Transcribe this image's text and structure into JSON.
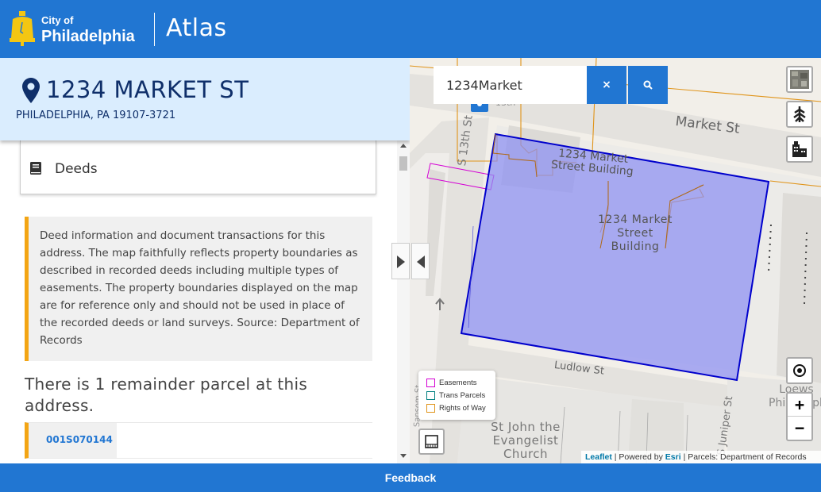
{
  "header": {
    "city_of": "City of",
    "city_name": "Philadelphia",
    "app_title": "Atlas"
  },
  "address": {
    "title": "1234 MARKET ST",
    "subtitle": "PHILADELPHIA, PA 19107-3721"
  },
  "topic": {
    "label": "Deeds",
    "icon": "book-icon"
  },
  "callout": {
    "text": "Deed information and document transactions for this address. The map faithfully reflects property boundaries as described in recorded deeds including multiple types of easements. The property boundaries displayed on the map are for reference only and should not be used in place of the recorded deeds or land surveys. Source: Department of Records"
  },
  "parcels": {
    "heading": "There is 1 remainder parcel at this address.",
    "rows": [
      {
        "id": "001S070144"
      }
    ]
  },
  "search": {
    "value": "1234Market",
    "clear_label": "×"
  },
  "map": {
    "labels": {
      "market_st": "Market St",
      "ludlow_st": "Ludlow St",
      "s_13th_st": "S 13th St",
      "s_juniper": "S Juniper St",
      "building_top": "1234 Market Street Building",
      "building_center": "1234 Market Street Building",
      "church": "St John the Evangelist Church",
      "right_edge": "Loews Philadelphia",
      "station_short": "13th",
      "sansom": "Sansom St"
    },
    "legend": [
      {
        "label": "Easements",
        "color": "#d400d4"
      },
      {
        "label": "Trans Parcels",
        "color": "#008080"
      },
      {
        "label": "Rights of Way",
        "color": "#e0941a"
      }
    ],
    "zoom_in": "+",
    "zoom_out": "−",
    "attribution": {
      "leaflet": "Leaflet",
      "powered": "| Powered by",
      "esri": "Esri",
      "parcels": "| Parcels: Department of Records"
    }
  },
  "footer": {
    "feedback": "Feedback"
  },
  "colors": {
    "brand_blue": "#2176d2",
    "address_bg": "#daedfe",
    "accent_orange": "#f3a514",
    "parcel_fill": "#8c8ff2",
    "parcel_stroke": "#0000cc"
  }
}
